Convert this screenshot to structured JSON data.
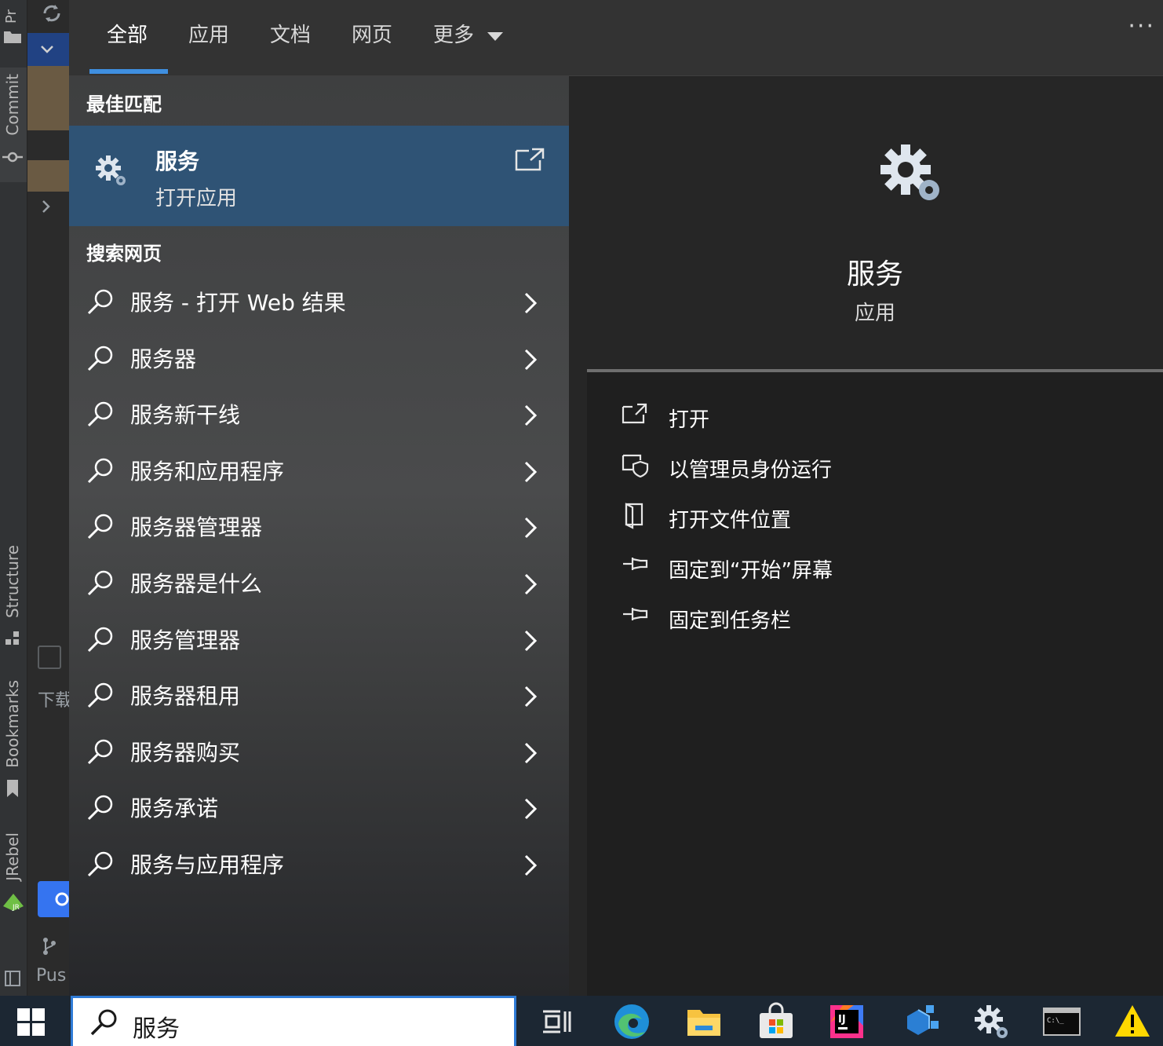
{
  "ide": {
    "vertical_tabs": [
      "Commit",
      "Structure",
      "Bookmarks",
      "JRebel"
    ],
    "top_partial_label": "Pr",
    "partial_text_1": "下载",
    "partial_text_2": "Pus"
  },
  "tabs": [
    {
      "label": "全部",
      "active": true
    },
    {
      "label": "应用",
      "active": false
    },
    {
      "label": "文档",
      "active": false
    },
    {
      "label": "网页",
      "active": false
    },
    {
      "label": "更多",
      "active": false
    }
  ],
  "more_menu": "···",
  "best_match": {
    "section_title": "最佳匹配",
    "name": "服务",
    "subtitle": "打开应用"
  },
  "web_search": {
    "section_title": "搜索网页",
    "items": [
      "服务 - 打开 Web 结果",
      "服务器",
      "服务新干线",
      "服务和应用程序",
      "服务器管理器",
      "服务器是什么",
      "服务管理器",
      "服务器租用",
      "服务器购买",
      "服务承诺",
      "服务与应用程序"
    ]
  },
  "detail": {
    "app_name": "服务",
    "app_type": "应用",
    "actions": [
      {
        "label": "打开",
        "icon": "open-icon"
      },
      {
        "label": "以管理员身份运行",
        "icon": "shield-icon"
      },
      {
        "label": "打开文件位置",
        "icon": "file-location-icon"
      },
      {
        "label": "固定到“开始”屏幕",
        "icon": "pin-icon"
      },
      {
        "label": "固定到任务栏",
        "icon": "pin-icon"
      }
    ]
  },
  "taskbar": {
    "search_value": "服务",
    "icons": [
      "task-view-icon",
      "edge-icon",
      "file-explorer-icon",
      "store-icon",
      "intellij-icon",
      "network-app-icon",
      "services-gear-icon",
      "terminal-icon",
      "warning-icon"
    ]
  },
  "colors": {
    "accent": "#3f8fe0",
    "best_match_bg": "#2f5375",
    "taskbar_bg": "#1c2733"
  }
}
